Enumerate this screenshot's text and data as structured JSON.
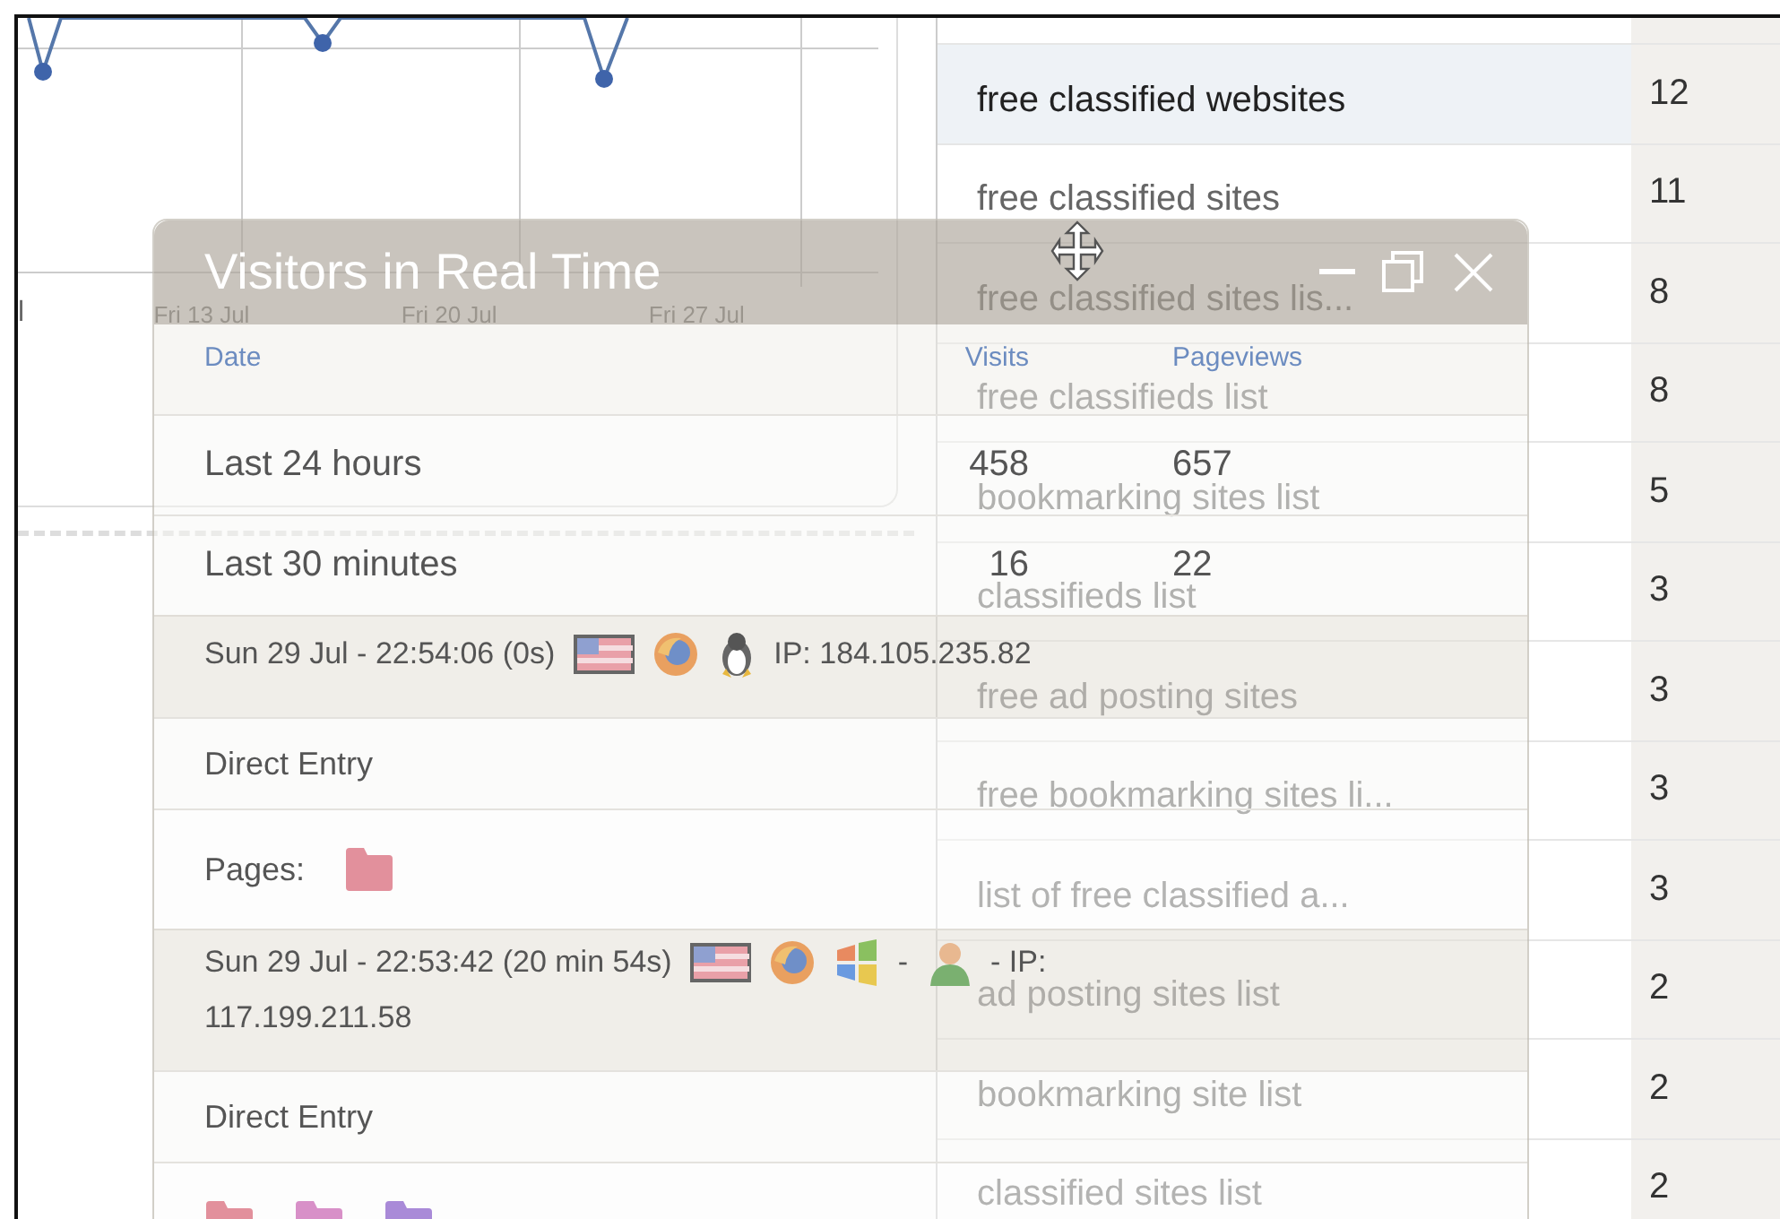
{
  "chart_panel": {
    "x_labels": [
      "l",
      "Fri 13 Jul",
      "Fri 20 Jul",
      "Fri 27 Jul"
    ]
  },
  "keywords": [
    {
      "keyword": "free classified websites",
      "count": "12",
      "highlighted": true
    },
    {
      "keyword": "free classified sites",
      "count": "11",
      "highlighted": false
    },
    {
      "keyword": "free classified sites lis...",
      "count": "8",
      "highlighted": false
    },
    {
      "keyword": "free classifieds list",
      "count": "8",
      "highlighted": false
    },
    {
      "keyword": "bookmarking sites list",
      "count": "5",
      "highlighted": false
    },
    {
      "keyword": "classifieds list",
      "count": "3",
      "highlighted": false
    },
    {
      "keyword": "free ad posting sites",
      "count": "3",
      "highlighted": false
    },
    {
      "keyword": "free bookmarking sites li...",
      "count": "3",
      "highlighted": false
    },
    {
      "keyword": "list of free classified a...",
      "count": "3",
      "highlighted": false
    },
    {
      "keyword": "ad posting sites list",
      "count": "2",
      "highlighted": false
    },
    {
      "keyword": "bookmarking site list",
      "count": "2",
      "highlighted": false
    },
    {
      "keyword": "classified sites list",
      "count": "2",
      "highlighted": false
    }
  ],
  "realtime_window": {
    "title": "Visitors in Real Time",
    "columns": [
      "Date",
      "Visits",
      "Pageviews"
    ],
    "summary": [
      {
        "period": "Last 24 hours",
        "visits": "458",
        "pageviews": "657"
      },
      {
        "period": "Last 30 minutes",
        "visits": "16",
        "pageviews": "22"
      }
    ],
    "visits": [
      {
        "parts": [
          {
            "kind": "text",
            "text": "Sun 29 Jul - 22:54:06 (0s)"
          },
          {
            "kind": "flag"
          },
          {
            "kind": "browser"
          },
          {
            "kind": "linux"
          },
          {
            "kind": "text",
            "text": "IP: 184.105.235.82"
          }
        ],
        "referrer": "Direct Entry",
        "pages_label": "Pages:",
        "pages": [
          {
            "color": "#e2909c"
          }
        ]
      },
      {
        "parts": [
          {
            "kind": "text",
            "text": "Sun 29 Jul - 22:53:42 (20 min 54s)"
          },
          {
            "kind": "flag"
          },
          {
            "kind": "browser"
          },
          {
            "kind": "windows"
          },
          {
            "kind": "text",
            "text": "-"
          },
          {
            "kind": "person"
          },
          {
            "kind": "text",
            "text": "- IP:"
          },
          {
            "kind": "break"
          },
          {
            "kind": "text",
            "text": "117.199.211.58"
          }
        ],
        "referrer": "Direct Entry",
        "pages": [
          {
            "color": "#e2909c"
          },
          {
            "color": "#d890c8"
          },
          {
            "color": "#a98ad8"
          }
        ]
      }
    ]
  }
}
